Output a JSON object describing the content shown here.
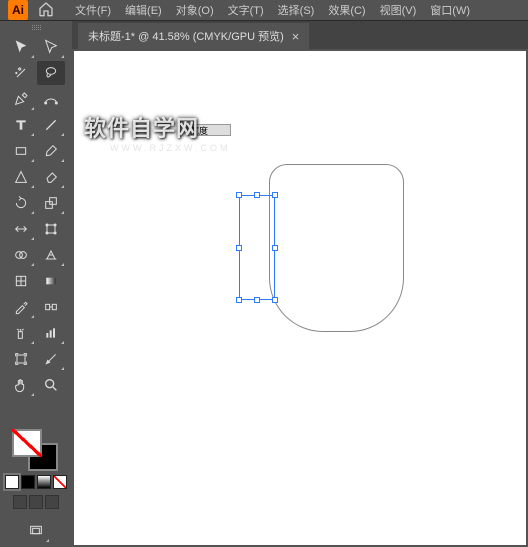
{
  "app": {
    "logo_text": "Ai"
  },
  "menu": {
    "file": "文件(F)",
    "edit": "编辑(E)",
    "object": "对象(O)",
    "type": "文字(T)",
    "select": "选择(S)",
    "effect": "效果(C)",
    "view": "视图(V)",
    "window": "窗口(W)"
  },
  "tab": {
    "title": "未标题-1* @ 41.58% (CMYK/GPU 预览)",
    "close": "×"
  },
  "tooltip": {
    "text": "宽度"
  },
  "watermark": {
    "main": "软件自学网",
    "sub": "WWW.RJZXW.COM"
  },
  "icons": {
    "home": "home-icon",
    "selection": "selection-tool",
    "direct": "direct-selection-tool",
    "magic": "magic-wand-tool",
    "lasso": "lasso-tool",
    "pen": "pen-tool",
    "curve": "curvature-tool",
    "type": "type-tool",
    "line": "line-tool",
    "rect": "rectangle-tool",
    "brush": "paintbrush-tool",
    "shaper": "shaper-tool",
    "eraser": "eraser-tool",
    "scissors": "scissors-tool",
    "rotate": "rotate-tool",
    "scale": "scale-tool",
    "width": "width-tool",
    "free": "free-transform-tool",
    "shapebuilder": "shape-builder-tool",
    "perspective": "perspective-grid-tool",
    "gradient": "gradient-tool",
    "mesh": "mesh-tool",
    "eyedrop": "eyedropper-tool",
    "blend": "blend-tool",
    "symbol": "symbol-sprayer-tool",
    "graph": "column-graph-tool",
    "artboard": "artboard-tool",
    "slice": "slice-tool",
    "hand": "hand-tool",
    "zoom": "zoom-tool"
  }
}
